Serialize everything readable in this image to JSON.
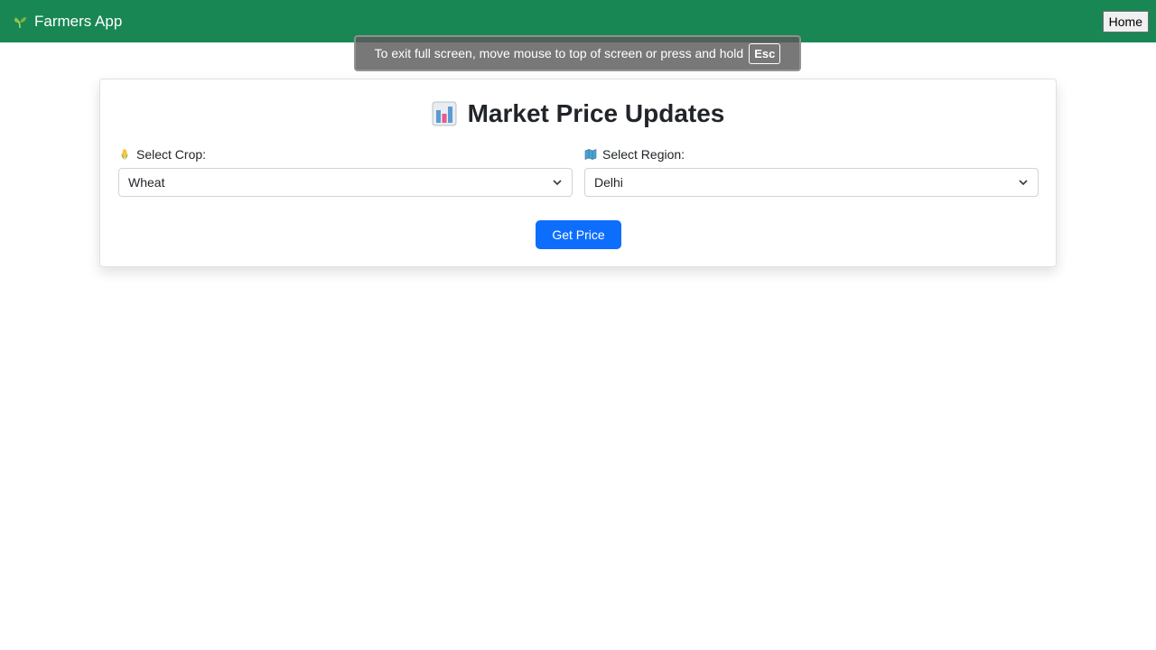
{
  "navbar": {
    "brand": "Farmers App",
    "brand_icon": "seedling-icon",
    "home_label": "Home",
    "color": "#198754"
  },
  "fullscreen_toast": {
    "message": "To exit full screen, move mouse to top of screen or press and hold",
    "key": "Esc"
  },
  "card": {
    "title": "Market Price Updates",
    "title_icon": "bar-chart-icon",
    "crop": {
      "label": "Select Crop:",
      "icon": "corn-icon",
      "value": "Wheat"
    },
    "region": {
      "label": "Select Region:",
      "icon": "map-icon",
      "value": "Delhi"
    },
    "button_label": "Get Price",
    "button_color": "#0d6efd"
  }
}
